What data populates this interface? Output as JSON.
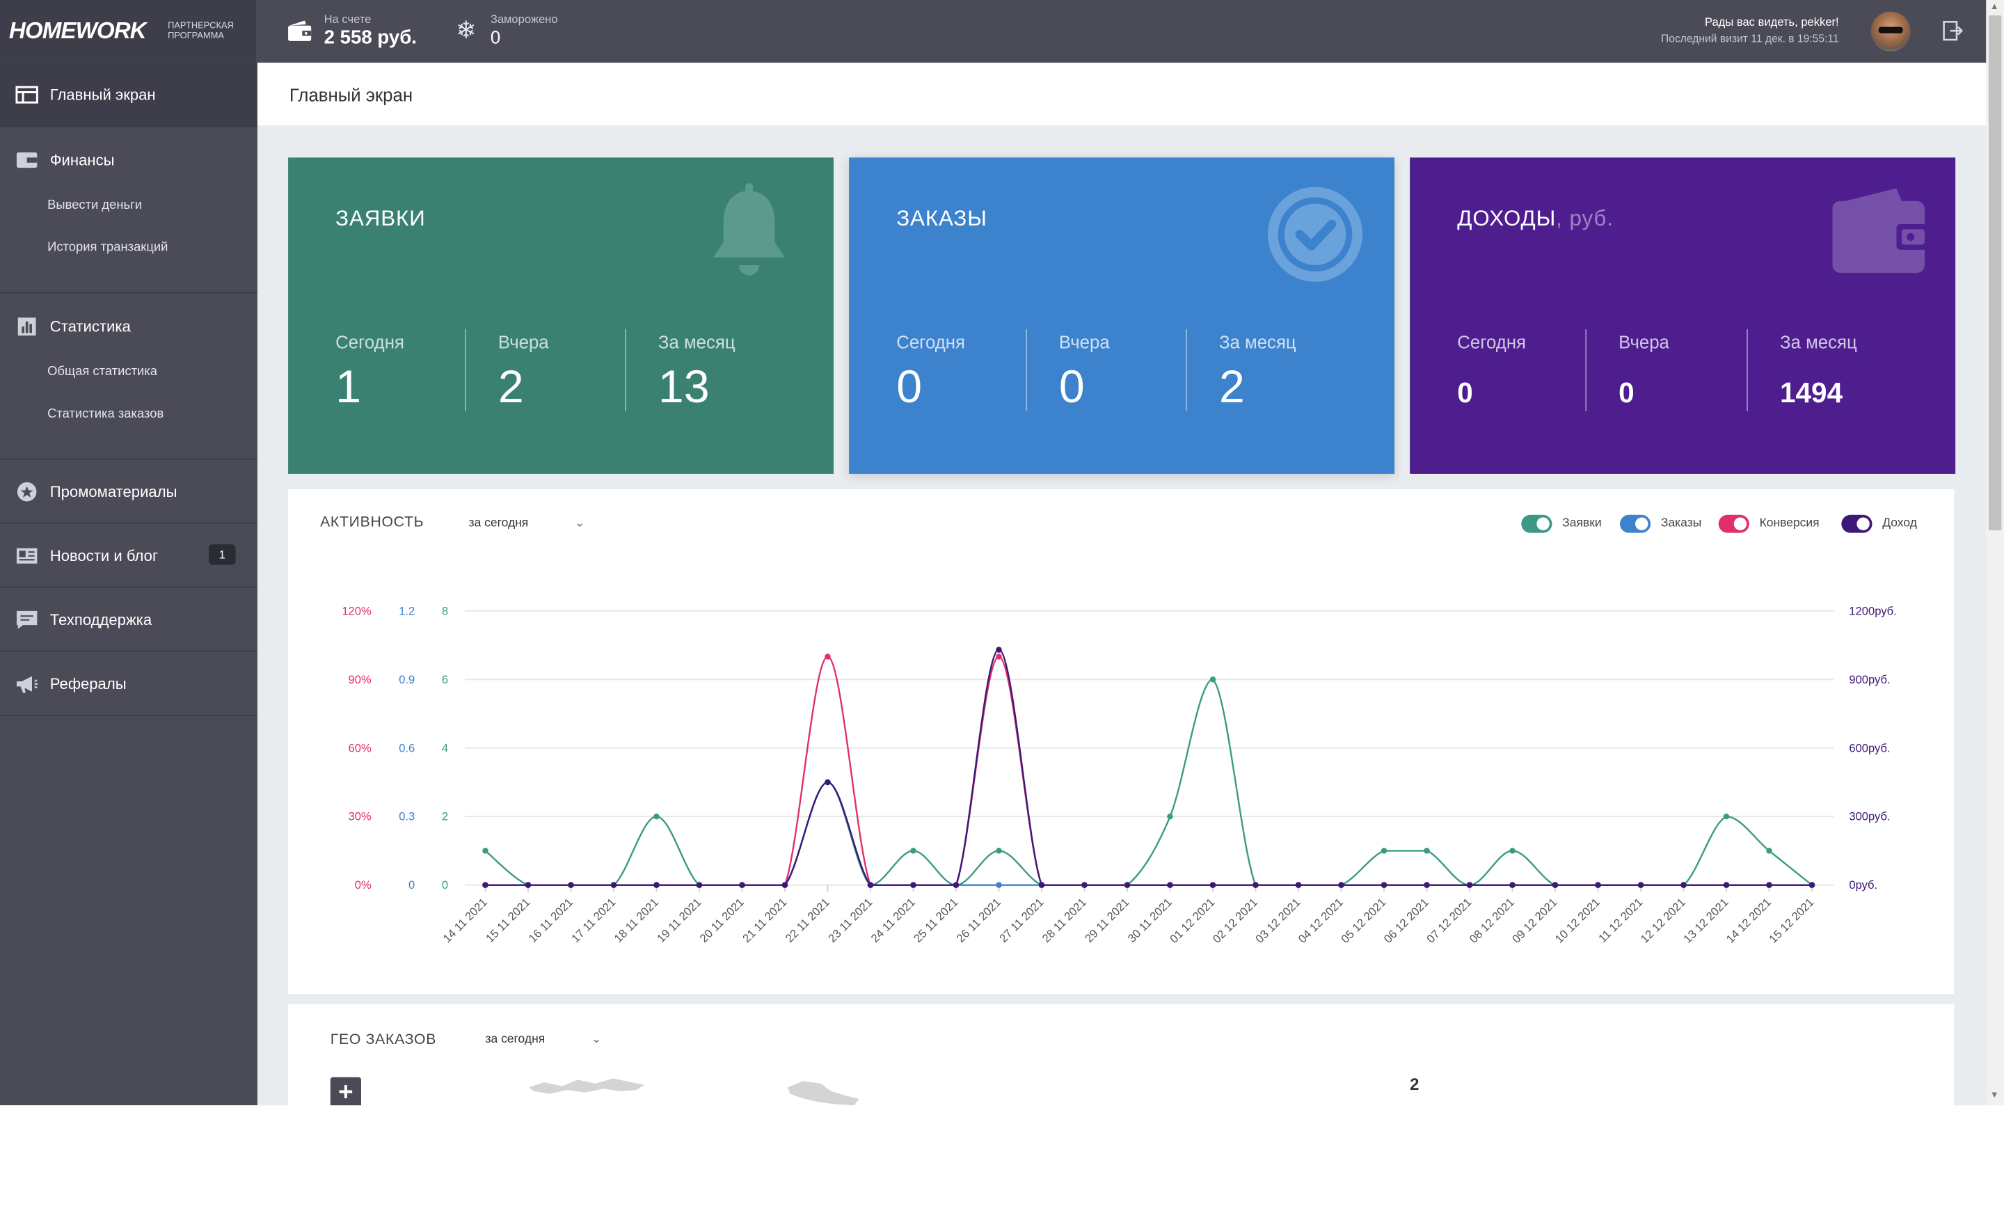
{
  "brand": {
    "logo": "HOMEWORK",
    "subtitle_line1": "ПАРТНЕРСКАЯ",
    "subtitle_line2": "ПРОГРАММА"
  },
  "topbar": {
    "balance_label": "На счете",
    "balance_value": "2 558 руб.",
    "frozen_label": "Заморожено",
    "frozen_value": "0",
    "greeting": "Рады вас видеть, pekker!",
    "last_visit": "Последний визит 11 дек. в 19:55:11"
  },
  "sidebar": {
    "main": "Главный экран",
    "finance": "Финансы",
    "finance_items": [
      "Вывести деньги",
      "История транзакций"
    ],
    "stats": "Статистика",
    "stats_items": [
      "Общая статистика",
      "Статистика заказов"
    ],
    "promo": "Промоматериалы",
    "news": "Новости и блог",
    "news_badge": "1",
    "support": "Техподдержка",
    "referrals": "Рефералы"
  },
  "header": {
    "title": "Главный экран"
  },
  "cards": {
    "requests": {
      "title": "ЗАЯВКИ",
      "labels": [
        "Сегодня",
        "Вчера",
        "За месяц"
      ],
      "values": [
        "1",
        "2",
        "13"
      ],
      "color": "#3a8172"
    },
    "orders": {
      "title": "ЗАКАЗЫ",
      "labels": [
        "Сегодня",
        "Вчера",
        "За месяц"
      ],
      "values": [
        "0",
        "0",
        "2"
      ],
      "color": "#3d82cc"
    },
    "income": {
      "title": "ДОХОДЫ",
      "unit": ", руб.",
      "labels": [
        "Сегодня",
        "Вчера",
        "За месяц"
      ],
      "values": [
        "0",
        "0",
        "1494"
      ],
      "color": "#4e1e8f"
    }
  },
  "activity": {
    "title": "АКТИВНОСТЬ",
    "period": "за сегодня",
    "legend": [
      {
        "label": "Заявки",
        "color": "#3a9a84"
      },
      {
        "label": "Заказы",
        "color": "#3d82cc"
      },
      {
        "label": "Конверсия",
        "color": "#e0306a"
      },
      {
        "label": "Доход",
        "color": "#3d1878"
      }
    ]
  },
  "chart_data": {
    "type": "line",
    "x": [
      "14 11 2021",
      "15 11 2021",
      "16 11 2021",
      "17 11 2021",
      "18 11 2021",
      "19 11 2021",
      "20 11 2021",
      "21 11 2021",
      "22 11 2021",
      "23 11 2021",
      "24 11 2021",
      "25 11 2021",
      "26 11 2021",
      "27 11 2021",
      "28 11 2021",
      "29 11 2021",
      "30 11 2021",
      "01 12 2021",
      "02 12 2021",
      "03 12 2021",
      "04 12 2021",
      "05 12 2021",
      "06 12 2021",
      "07 12 2021",
      "08 12 2021",
      "09 12 2021",
      "10 12 2021",
      "11 12 2021",
      "12 12 2021",
      "13 12 2021",
      "14 12 2021",
      "15 12 2021"
    ],
    "series": [
      {
        "name": "Заявки",
        "axis": "y_count",
        "color": "#3a9a84",
        "values": [
          1,
          0,
          0,
          0,
          2,
          0,
          0,
          0,
          3,
          0,
          1,
          0,
          1,
          0,
          0,
          0,
          2,
          6,
          0,
          0,
          0,
          1,
          1,
          0,
          1,
          0,
          0,
          0,
          0,
          2,
          1,
          0
        ]
      },
      {
        "name": "Заказы",
        "axis": "y_orders",
        "color": "#3d82cc",
        "values": [
          0,
          0,
          0,
          0,
          0,
          0,
          0,
          0,
          0.45,
          0,
          0,
          0,
          0,
          0,
          0,
          0,
          0,
          0,
          0,
          0,
          0,
          0,
          0,
          0,
          0,
          0,
          0,
          0,
          0,
          0,
          0,
          0
        ]
      },
      {
        "name": "Конверсия",
        "axis": "y_percent",
        "color": "#e0306a",
        "values": [
          0,
          0,
          0,
          0,
          0,
          0,
          0,
          0,
          100,
          0,
          0,
          0,
          100,
          0,
          0,
          0,
          0,
          0,
          0,
          0,
          0,
          0,
          0,
          0,
          0,
          0,
          0,
          0,
          0,
          0,
          0,
          0
        ]
      },
      {
        "name": "Доход",
        "axis": "y_rub",
        "color": "#3d1878",
        "values": [
          0,
          0,
          0,
          0,
          0,
          0,
          0,
          0,
          450,
          0,
          0,
          0,
          1030,
          0,
          0,
          0,
          0,
          0,
          0,
          0,
          0,
          0,
          0,
          0,
          0,
          0,
          0,
          0,
          0,
          0,
          0,
          0
        ]
      }
    ],
    "axes": {
      "y_percent": {
        "ticks": [
          "0%",
          "30%",
          "60%",
          "90%",
          "120%"
        ],
        "range": [
          0,
          120
        ],
        "color": "#e0306a"
      },
      "y_orders": {
        "ticks": [
          "0",
          "0.3",
          "0.6",
          "0.9",
          "1.2"
        ],
        "range": [
          0,
          1.2
        ],
        "color": "#3d82cc"
      },
      "y_count": {
        "ticks": [
          "0",
          "2",
          "4",
          "6",
          "8"
        ],
        "range": [
          0,
          8
        ],
        "color": "#3a9a84"
      },
      "y_rub": {
        "ticks": [
          "0руб.",
          "300руб.",
          "600руб.",
          "900руб.",
          "1200руб."
        ],
        "range": [
          0,
          1200
        ],
        "color": "#3d1878"
      }
    },
    "grid": true
  },
  "geo": {
    "title": "ГЕО ЗАКАЗОВ",
    "period": "за сегодня",
    "count": "2"
  }
}
